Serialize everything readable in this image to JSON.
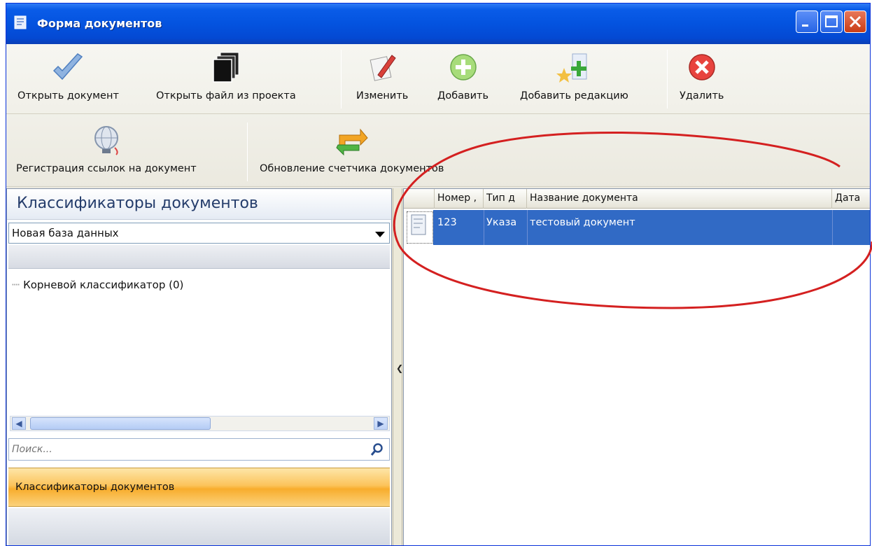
{
  "window": {
    "title": "Форма документов"
  },
  "toolbar": {
    "row1": [
      {
        "label": "Открыть документ",
        "icon": "checkmark-document-icon"
      },
      {
        "label": "Открыть файл из проекта",
        "icon": "stacked-documents-icon"
      },
      {
        "label": "Изменить",
        "icon": "edit-pencil-icon"
      },
      {
        "label": "Добавить",
        "icon": "add-plus-icon"
      },
      {
        "label": "Добавить редакцию",
        "icon": "add-revision-icon"
      },
      {
        "label": "Удалить",
        "icon": "delete-x-icon"
      }
    ],
    "row2": [
      {
        "label": "Регистрация ссылок на документ",
        "icon": "globe-link-icon"
      },
      {
        "label": "Обновление счетчика документов",
        "icon": "refresh-arrows-icon"
      }
    ]
  },
  "left_pane": {
    "title": "Классификаторы документов",
    "database_select": "Новая база данных",
    "tree": [
      {
        "label": "Корневой классификатор (0)"
      }
    ],
    "search": {
      "placeholder": "Поиск..."
    },
    "nav_active": "Классификаторы документов"
  },
  "grid": {
    "columns": [
      "Номер ,",
      "Тип д",
      "Название документа",
      "Дата"
    ],
    "rows": [
      {
        "number": "123",
        "type": "Указа",
        "name": "тестовый документ",
        "date": ""
      }
    ]
  },
  "colors": {
    "title_bar": "#0453df",
    "selection": "#316ac5",
    "nav_active": "#fcc45c",
    "annotation_ellipse": "#d42020"
  }
}
